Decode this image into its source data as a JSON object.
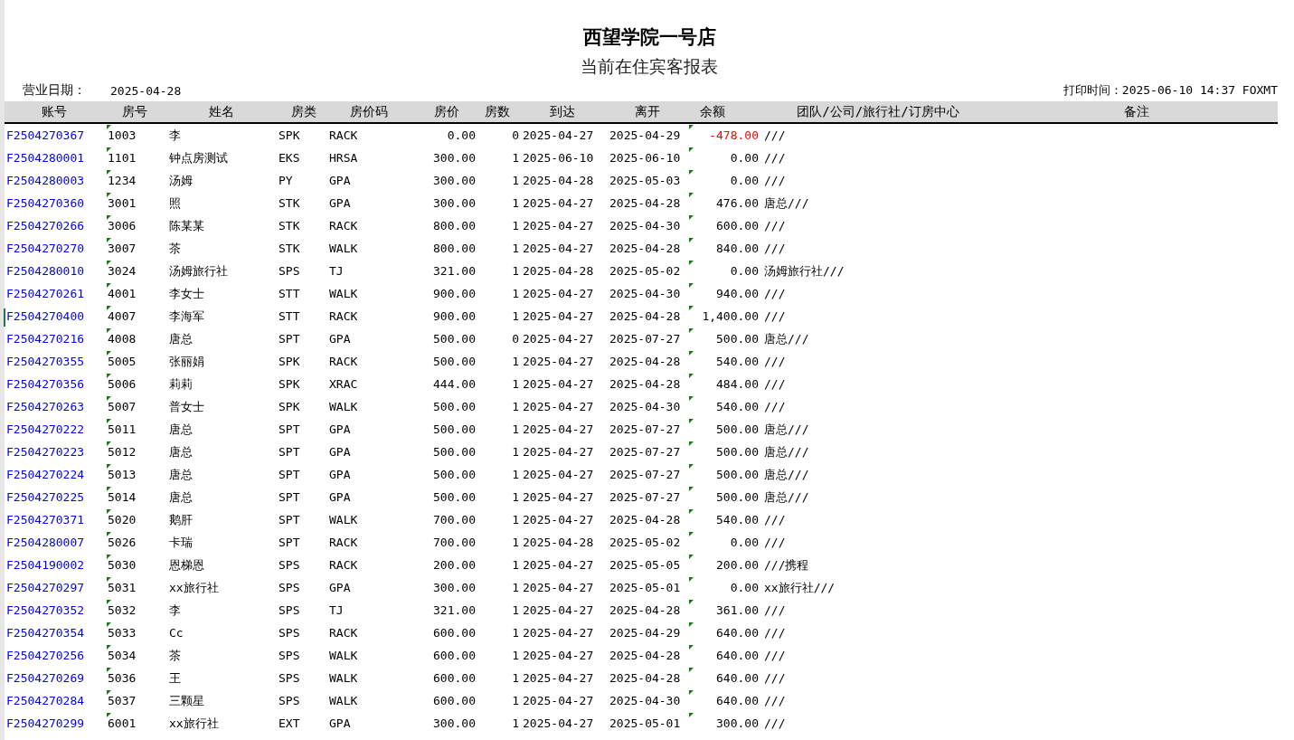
{
  "report": {
    "title": "西望学院一号店",
    "subtitle": "当前在住宾客报表",
    "business_date_label": "营业日期：",
    "business_date": "2025-04-28",
    "print_time": "打印时间：2025-06-10 14:37 FOXMT"
  },
  "table": {
    "columns": [
      "账号",
      "房号",
      "姓名",
      "房类",
      "房价码",
      "房价",
      "房数",
      "到达",
      "离开",
      "余额",
      "团队/公司/旅行社/订房中心",
      "备注"
    ],
    "rows": [
      {
        "cells": [
          "F2504270367",
          "1003",
          "李",
          "SPK",
          "RACK",
          "0.00",
          "0",
          "2025-04-27",
          "2025-04-29",
          "-478.00",
          "///"
        ],
        "negative": true,
        "selected": false
      },
      {
        "cells": [
          "F2504280001",
          "1101",
          "钟点房测试",
          "EKS",
          "HRSA",
          "300.00",
          "1",
          "2025-06-10",
          "2025-06-10",
          "0.00",
          "///"
        ],
        "negative": false,
        "selected": false
      },
      {
        "cells": [
          "F2504280003",
          "1234",
          "汤姆",
          "PY",
          "GPA",
          "300.00",
          "1",
          "2025-04-28",
          "2025-05-03",
          "0.00",
          "///"
        ],
        "negative": false,
        "selected": false
      },
      {
        "cells": [
          "F2504270360",
          "3001",
          "照",
          "STK",
          "GPA",
          "300.00",
          "1",
          "2025-04-27",
          "2025-04-28",
          "476.00",
          "唐总///"
        ],
        "negative": false,
        "selected": false
      },
      {
        "cells": [
          "F2504270266",
          "3006",
          "陈某某",
          "STK",
          "RACK",
          "800.00",
          "1",
          "2025-04-27",
          "2025-04-30",
          "600.00",
          "///"
        ],
        "negative": false,
        "selected": false
      },
      {
        "cells": [
          "F2504270270",
          "3007",
          "茶",
          "STK",
          "WALK",
          "800.00",
          "1",
          "2025-04-27",
          "2025-04-28",
          "840.00",
          "///"
        ],
        "negative": false,
        "selected": false
      },
      {
        "cells": [
          "F2504280010",
          "3024",
          "汤姆旅行社",
          "SPS",
          "TJ",
          "321.00",
          "1",
          "2025-04-28",
          "2025-05-02",
          "0.00",
          "汤姆旅行社///"
        ],
        "negative": false,
        "selected": false
      },
      {
        "cells": [
          "F2504270261",
          "4001",
          "李女士",
          "STT",
          "WALK",
          "900.00",
          "1",
          "2025-04-27",
          "2025-04-30",
          "940.00",
          "///"
        ],
        "negative": false,
        "selected": false
      },
      {
        "cells": [
          "F2504270400",
          "4007",
          "李海军",
          "STT",
          "RACK",
          "900.00",
          "1",
          "2025-04-27",
          "2025-04-28",
          "1,400.00",
          "///"
        ],
        "negative": false,
        "selected": true
      },
      {
        "cells": [
          "F2504270216",
          "4008",
          "唐总",
          "SPT",
          "GPA",
          "500.00",
          "0",
          "2025-04-27",
          "2025-07-27",
          "500.00",
          "唐总///"
        ],
        "negative": false,
        "selected": false
      },
      {
        "cells": [
          "F2504270355",
          "5005",
          "张丽娟",
          "SPK",
          "RACK",
          "500.00",
          "1",
          "2025-04-27",
          "2025-04-28",
          "540.00",
          "///"
        ],
        "negative": false,
        "selected": false
      },
      {
        "cells": [
          "F2504270356",
          "5006",
          "莉莉",
          "SPK",
          "XRAC",
          "444.00",
          "1",
          "2025-04-27",
          "2025-04-28",
          "484.00",
          "///"
        ],
        "negative": false,
        "selected": false
      },
      {
        "cells": [
          "F2504270263",
          "5007",
          "普女士",
          "SPK",
          "WALK",
          "500.00",
          "1",
          "2025-04-27",
          "2025-04-30",
          "540.00",
          "///"
        ],
        "negative": false,
        "selected": false
      },
      {
        "cells": [
          "F2504270222",
          "5011",
          "唐总",
          "SPT",
          "GPA",
          "500.00",
          "1",
          "2025-04-27",
          "2025-07-27",
          "500.00",
          "唐总///"
        ],
        "negative": false,
        "selected": false
      },
      {
        "cells": [
          "F2504270223",
          "5012",
          "唐总",
          "SPT",
          "GPA",
          "500.00",
          "1",
          "2025-04-27",
          "2025-07-27",
          "500.00",
          "唐总///"
        ],
        "negative": false,
        "selected": false
      },
      {
        "cells": [
          "F2504270224",
          "5013",
          "唐总",
          "SPT",
          "GPA",
          "500.00",
          "1",
          "2025-04-27",
          "2025-07-27",
          "500.00",
          "唐总///"
        ],
        "negative": false,
        "selected": false
      },
      {
        "cells": [
          "F2504270225",
          "5014",
          "唐总",
          "SPT",
          "GPA",
          "500.00",
          "1",
          "2025-04-27",
          "2025-07-27",
          "500.00",
          "唐总///"
        ],
        "negative": false,
        "selected": false
      },
      {
        "cells": [
          "F2504270371",
          "5020",
          "鹅肝",
          "SPT",
          "WALK",
          "700.00",
          "1",
          "2025-04-27",
          "2025-04-28",
          "540.00",
          "///"
        ],
        "negative": false,
        "selected": false
      },
      {
        "cells": [
          "F2504280007",
          "5026",
          "卡瑞",
          "SPT",
          "RACK",
          "700.00",
          "1",
          "2025-04-28",
          "2025-05-02",
          "0.00",
          "///"
        ],
        "negative": false,
        "selected": false
      },
      {
        "cells": [
          "F2504190002",
          "5030",
          "恩梯恩",
          "SPS",
          "RACK",
          "200.00",
          "1",
          "2025-04-27",
          "2025-05-05",
          "200.00",
          "///携程"
        ],
        "negative": false,
        "selected": false
      },
      {
        "cells": [
          "F2504270297",
          "5031",
          "xx旅行社",
          "SPS",
          "GPA",
          "300.00",
          "1",
          "2025-04-27",
          "2025-05-01",
          "0.00",
          "xx旅行社///"
        ],
        "negative": false,
        "selected": false
      },
      {
        "cells": [
          "F2504270352",
          "5032",
          "李",
          "SPS",
          "TJ",
          "321.00",
          "1",
          "2025-04-27",
          "2025-04-28",
          "361.00",
          "///"
        ],
        "negative": false,
        "selected": false
      },
      {
        "cells": [
          "F2504270354",
          "5033",
          "Cc",
          "SPS",
          "RACK",
          "600.00",
          "1",
          "2025-04-27",
          "2025-04-29",
          "640.00",
          "///"
        ],
        "negative": false,
        "selected": false
      },
      {
        "cells": [
          "F2504270256",
          "5034",
          "茶",
          "SPS",
          "WALK",
          "600.00",
          "1",
          "2025-04-27",
          "2025-04-28",
          "640.00",
          "///"
        ],
        "negative": false,
        "selected": false
      },
      {
        "cells": [
          "F2504270269",
          "5036",
          "王",
          "SPS",
          "WALK",
          "600.00",
          "1",
          "2025-04-27",
          "2025-04-28",
          "640.00",
          "///"
        ],
        "negative": false,
        "selected": false
      },
      {
        "cells": [
          "F2504270284",
          "5037",
          "三颗星",
          "SPS",
          "WALK",
          "600.00",
          "1",
          "2025-04-27",
          "2025-04-30",
          "640.00",
          "///"
        ],
        "negative": false,
        "selected": false
      },
      {
        "cells": [
          "F2504270299",
          "6001",
          "xx旅行社",
          "EXT",
          "GPA",
          "300.00",
          "1",
          "2025-04-27",
          "2025-05-01",
          "300.00",
          "///"
        ],
        "negative": false,
        "selected": false
      }
    ]
  }
}
